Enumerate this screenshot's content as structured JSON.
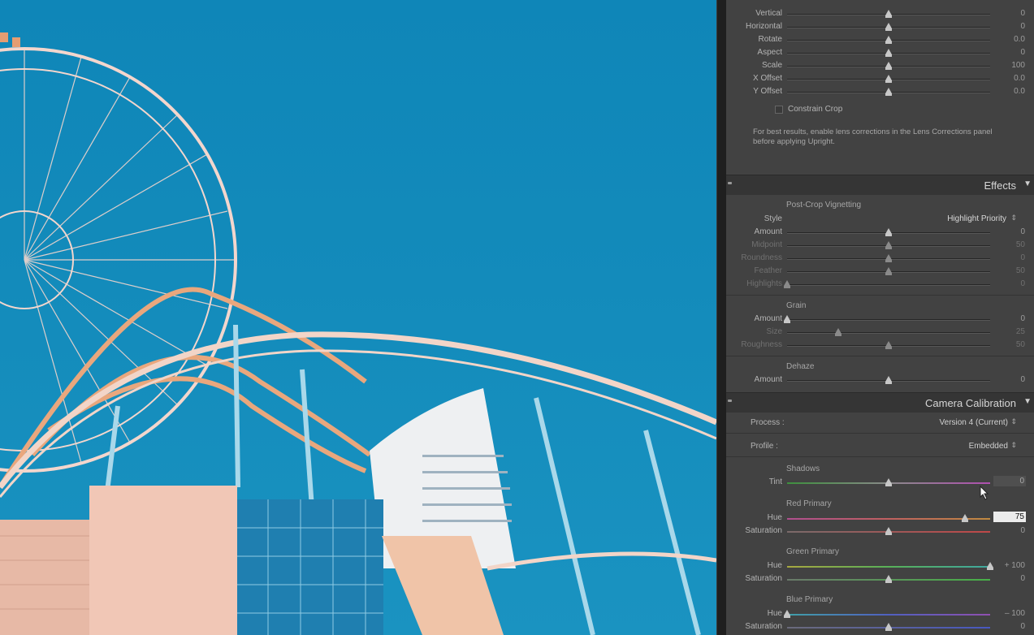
{
  "photo": {
    "alt": "photo-preview"
  },
  "transform": {
    "rows": [
      {
        "label": "Vertical",
        "value": "0",
        "pos": 0.5
      },
      {
        "label": "Horizontal",
        "value": "0",
        "pos": 0.5
      },
      {
        "label": "Rotate",
        "value": "0.0",
        "pos": 0.5
      },
      {
        "label": "Aspect",
        "value": "0",
        "pos": 0.5
      },
      {
        "label": "Scale",
        "value": "100",
        "pos": 0.5
      },
      {
        "label": "X Offset",
        "value": "0.0",
        "pos": 0.5
      },
      {
        "label": "Y Offset",
        "value": "0.0",
        "pos": 0.5
      }
    ],
    "constrain_crop_label": "Constrain Crop",
    "note": "For best results, enable lens corrections in the Lens Corrections panel before applying Upright."
  },
  "effects": {
    "title": "Effects",
    "toggle": "▼",
    "vignette_title": "Post-Crop Vignetting",
    "style_label": "Style",
    "style_value": "Highlight Priority",
    "vignette_rows": [
      {
        "label": "Amount",
        "value": "0",
        "pos": 0.5,
        "dim": false
      },
      {
        "label": "Midpoint",
        "value": "50",
        "pos": 0.5,
        "dim": true
      },
      {
        "label": "Roundness",
        "value": "0",
        "pos": 0.5,
        "dim": true
      },
      {
        "label": "Feather",
        "value": "50",
        "pos": 0.5,
        "dim": true
      },
      {
        "label": "Highlights",
        "value": "0",
        "pos": 0.0,
        "dim": true
      }
    ],
    "grain_title": "Grain",
    "grain_rows": [
      {
        "label": "Amount",
        "value": "0",
        "pos": 0.0,
        "dim": false
      },
      {
        "label": "Size",
        "value": "25",
        "pos": 0.25,
        "dim": true
      },
      {
        "label": "Roughness",
        "value": "50",
        "pos": 0.5,
        "dim": true
      }
    ],
    "dehaze_title": "Dehaze",
    "dehaze_rows": [
      {
        "label": "Amount",
        "value": "0",
        "pos": 0.5,
        "dim": false
      }
    ]
  },
  "calibration": {
    "title": "Camera Calibration",
    "toggle": "▼",
    "process_label": "Process :",
    "process_value": "Version 4 (Current)",
    "profile_label": "Profile :",
    "profile_value": "Embedded",
    "shadows_title": "Shadows",
    "tint": {
      "label": "Tint",
      "value": "0",
      "pos": 0.5
    },
    "red_title": "Red Primary",
    "red_hue": {
      "label": "Hue",
      "value": "75",
      "pos": 0.875
    },
    "red_sat": {
      "label": "Saturation",
      "value": "0",
      "pos": 0.5
    },
    "green_title": "Green Primary",
    "green_hue": {
      "label": "Hue",
      "value": "+ 100",
      "pos": 1.0
    },
    "green_sat": {
      "label": "Saturation",
      "value": "0",
      "pos": 0.5
    },
    "blue_title": "Blue Primary",
    "blue_hue": {
      "label": "Hue",
      "value": "– 100",
      "pos": 0.0
    },
    "blue_sat": {
      "label": "Saturation",
      "value": "0",
      "pos": 0.5
    }
  },
  "colors": {
    "panel_bg": "#434343",
    "sky": "#138bbb",
    "building": "#f1c7b6",
    "coaster": "#e9a77d"
  }
}
